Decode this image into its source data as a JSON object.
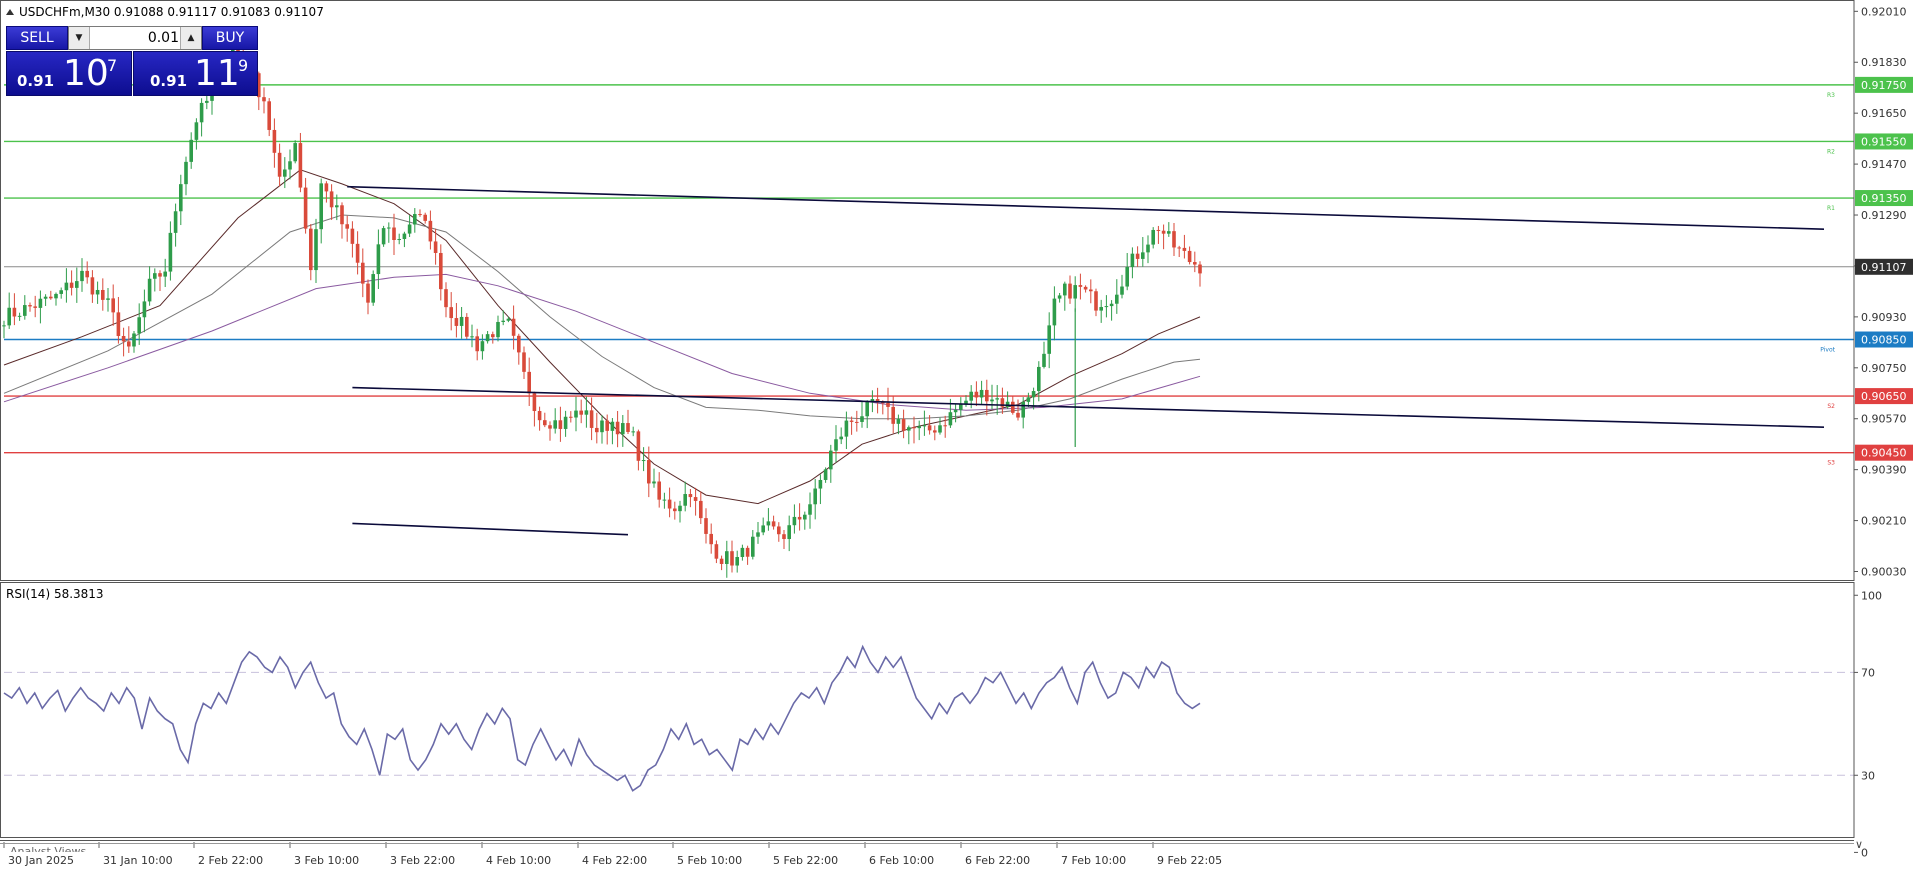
{
  "header": {
    "symbol_line": "USDCHFm,M30  0.91088 0.91117 0.91083 0.91107",
    "symbol_icon": "triangle-up-icon"
  },
  "trade_panel": {
    "sell_label": "SELL",
    "buy_label": "BUY",
    "lot_value": "0.01",
    "bid_prefix": "0.91",
    "bid_big": "10",
    "bid_sup": "7",
    "ask_prefix": "0.91",
    "ask_big": "11",
    "ask_sup": "9",
    "button_color": "#2323b8"
  },
  "indicator": {
    "label": "RSI(14) 58.3813"
  },
  "bottom_tab": "Analyst Views",
  "chart_data": [
    {
      "type": "candlestick",
      "symbol": "USDCHFm",
      "timeframe": "M30",
      "ylim": [
        0.9,
        0.9205
      ],
      "y_ticks": [
        "0.92010",
        "0.91830",
        "0.91650",
        "0.91470",
        "0.91290",
        "0.91110",
        "0.90930",
        "0.90750",
        "0.90570",
        "0.90390",
        "0.90210",
        "0.90030"
      ],
      "x_ticks": [
        "30 Jan 2025",
        "31 Jan 10:00",
        "2 Feb 22:00",
        "3 Feb 10:00",
        "3 Feb 22:00",
        "4 Feb 10:00",
        "4 Feb 22:00",
        "5 Feb 10:00",
        "5 Feb 22:00",
        "6 Feb 10:00",
        "6 Feb 22:00",
        "7 Feb 10:00",
        "9 Feb 22:05"
      ],
      "current_price": {
        "value": 0.91107,
        "label": "0.91107",
        "color": "#2f2f2f"
      },
      "levels": [
        {
          "name": "R3",
          "value": 0.9175,
          "label": "0.91750",
          "color": "#4cc24c"
        },
        {
          "name": "R2",
          "value": 0.9155,
          "label": "0.91550",
          "color": "#4cc24c"
        },
        {
          "name": "R1",
          "value": 0.9135,
          "label": "0.91350",
          "color": "#4cc24c"
        },
        {
          "name": "Pivot",
          "value": 0.9085,
          "label": "0.90850",
          "color": "#1c7cc4"
        },
        {
          "name": "S2",
          "value": 0.9065,
          "label": "0.90650",
          "color": "#e04040"
        },
        {
          "name": "S3",
          "value": 0.9045,
          "label": "0.90450",
          "color": "#e04040"
        }
      ],
      "key_points": [
        [
          0,
          0.9093
        ],
        [
          10,
          0.91
        ],
        [
          15,
          0.9108
        ],
        [
          20,
          0.9097
        ],
        [
          24,
          0.908
        ],
        [
          28,
          0.9104
        ],
        [
          31,
          0.911
        ],
        [
          34,
          0.9142
        ],
        [
          37,
          0.9163
        ],
        [
          40,
          0.9172
        ],
        [
          44,
          0.9189
        ],
        [
          47,
          0.918
        ],
        [
          50,
          0.917
        ],
        [
          53,
          0.914
        ],
        [
          56,
          0.9155
        ],
        [
          59,
          0.911
        ],
        [
          61,
          0.914
        ],
        [
          64,
          0.913
        ],
        [
          67,
          0.9118
        ],
        [
          70,
          0.9098
        ],
        [
          73,
          0.9125
        ],
        [
          76,
          0.912
        ],
        [
          79,
          0.913
        ],
        [
          82,
          0.9122
        ],
        [
          85,
          0.9097
        ],
        [
          88,
          0.909
        ],
        [
          91,
          0.9083
        ],
        [
          94,
          0.9088
        ],
        [
          97,
          0.909
        ],
        [
          100,
          0.9072
        ],
        [
          103,
          0.9058
        ],
        [
          107,
          0.9055
        ],
        [
          111,
          0.906
        ],
        [
          114,
          0.9053
        ],
        [
          117,
          0.9056
        ],
        [
          121,
          0.905
        ],
        [
          123,
          0.904
        ],
        [
          126,
          0.9028
        ],
        [
          129,
          0.9026
        ],
        [
          132,
          0.9032
        ],
        [
          135,
          0.9015
        ],
        [
          138,
          0.9008
        ],
        [
          141,
          0.9007
        ],
        [
          144,
          0.9013
        ],
        [
          147,
          0.9018
        ],
        [
          150,
          0.9016
        ],
        [
          153,
          0.9022
        ],
        [
          156,
          0.903
        ],
        [
          159,
          0.9045
        ],
        [
          162,
          0.9055
        ],
        [
          165,
          0.9059
        ],
        [
          168,
          0.9062
        ],
        [
          171,
          0.9057
        ],
        [
          174,
          0.9054
        ],
        [
          177,
          0.9052
        ],
        [
          180,
          0.9055
        ],
        [
          183,
          0.906
        ],
        [
          186,
          0.9065
        ],
        [
          189,
          0.9066
        ],
        [
          192,
          0.9063
        ],
        [
          195,
          0.9059
        ],
        [
          197,
          0.9065
        ],
        [
          200,
          0.9078
        ],
        [
          202,
          0.9097
        ],
        [
          204,
          0.9102
        ],
        [
          207,
          0.9103
        ],
        [
          210,
          0.9098
        ],
        [
          213,
          0.91
        ],
        [
          216,
          0.911
        ],
        [
          219,
          0.9118
        ],
        [
          222,
          0.9125
        ],
        [
          225,
          0.9118
        ],
        [
          228,
          0.9113
        ],
        [
          230,
          0.9111
        ]
      ],
      "moving_averages": [
        {
          "color": "#5a2a2a",
          "points": [
            [
              0,
              0.9076
            ],
            [
              15,
              0.9086
            ],
            [
              30,
              0.9097
            ],
            [
              45,
              0.9128
            ],
            [
              57,
              0.9145
            ],
            [
              65,
              0.914
            ],
            [
              75,
              0.9133
            ],
            [
              85,
              0.912
            ],
            [
              95,
              0.9097
            ],
            [
              105,
              0.9077
            ],
            [
              115,
              0.9058
            ],
            [
              125,
              0.9041
            ],
            [
              135,
              0.903
            ],
            [
              145,
              0.9027
            ],
            [
              155,
              0.9035
            ],
            [
              165,
              0.9048
            ],
            [
              175,
              0.9054
            ],
            [
              185,
              0.9058
            ],
            [
              195,
              0.9062
            ],
            [
              205,
              0.9072
            ],
            [
              215,
              0.908
            ],
            [
              222,
              0.9087
            ],
            [
              230,
              0.9093
            ]
          ]
        },
        {
          "color": "#7a7a7a",
          "points": [
            [
              0,
              0.9066
            ],
            [
              20,
              0.9081
            ],
            [
              40,
              0.9101
            ],
            [
              55,
              0.9123
            ],
            [
              65,
              0.9129
            ],
            [
              75,
              0.9128
            ],
            [
              85,
              0.9123
            ],
            [
              95,
              0.9109
            ],
            [
              105,
              0.9093
            ],
            [
              115,
              0.9079
            ],
            [
              125,
              0.9068
            ],
            [
              135,
              0.9061
            ],
            [
              145,
              0.906
            ],
            [
              155,
              0.9058
            ],
            [
              165,
              0.9057
            ],
            [
              175,
              0.9057
            ],
            [
              185,
              0.9058
            ],
            [
              195,
              0.906
            ],
            [
              205,
              0.9064
            ],
            [
              215,
              0.9071
            ],
            [
              225,
              0.9077
            ],
            [
              230,
              0.9078
            ]
          ]
        },
        {
          "color": "#8a5aa0",
          "points": [
            [
              0,
              0.9063
            ],
            [
              20,
              0.9075
            ],
            [
              40,
              0.9088
            ],
            [
              60,
              0.9103
            ],
            [
              75,
              0.9107
            ],
            [
              85,
              0.9108
            ],
            [
              95,
              0.9104
            ],
            [
              110,
              0.9095
            ],
            [
              125,
              0.9084
            ],
            [
              140,
              0.9073
            ],
            [
              155,
              0.9066
            ],
            [
              170,
              0.9062
            ],
            [
              185,
              0.906
            ],
            [
              200,
              0.9061
            ],
            [
              215,
              0.9064
            ],
            [
              230,
              0.9072
            ]
          ]
        }
      ],
      "trendlines": [
        {
          "color": "#0a0a3a",
          "from": [
            66,
            0.9139
          ],
          "to": [
            350,
            0.9124
          ]
        },
        {
          "color": "#0a0a3a",
          "from": [
            67,
            0.9068
          ],
          "to": [
            350,
            0.9054
          ]
        },
        {
          "color": "#0a0a3a",
          "from": [
            67,
            0.902
          ],
          "to": [
            120,
            0.9016
          ]
        }
      ],
      "spike_wick": {
        "x": 206,
        "high": 0.9096,
        "low": 0.9047
      }
    },
    {
      "type": "line",
      "title": "RSI(14) 58.3813",
      "ylim": [
        0,
        100
      ],
      "y_ticks": [
        "100",
        "70",
        "30",
        "0"
      ],
      "levels": [
        70,
        30
      ],
      "series": [
        {
          "color": "#6a6aa8",
          "values": [
            62,
            60,
            64,
            58,
            62,
            56,
            60,
            63,
            55,
            60,
            64,
            60,
            58,
            55,
            62,
            58,
            64,
            60,
            48,
            60,
            55,
            52,
            50,
            40,
            35,
            50,
            58,
            56,
            62,
            58,
            66,
            74,
            78,
            76,
            72,
            70,
            76,
            72,
            64,
            70,
            74,
            66,
            60,
            62,
            50,
            45,
            42,
            48,
            40,
            30,
            46,
            44,
            48,
            36,
            32,
            36,
            42,
            50,
            46,
            50,
            44,
            40,
            48,
            54,
            50,
            56,
            52,
            36,
            34,
            42,
            48,
            42,
            36,
            40,
            34,
            44,
            38,
            34,
            32,
            30,
            28,
            30,
            24,
            26,
            32,
            34,
            40,
            48,
            44,
            50,
            42,
            44,
            38,
            40,
            36,
            32,
            44,
            42,
            48,
            44,
            50,
            46,
            52,
            58,
            62,
            60,
            64,
            58,
            66,
            70,
            76,
            72,
            80,
            74,
            70,
            76,
            72,
            76,
            68,
            60,
            56,
            52,
            58,
            54,
            60,
            62,
            58,
            62,
            68,
            66,
            70,
            64,
            58,
            62,
            56,
            62,
            66,
            68,
            72,
            64,
            58,
            70,
            74,
            66,
            60,
            62,
            70,
            68,
            64,
            72,
            68,
            74,
            72,
            62,
            58,
            56,
            58
          ]
        }
      ]
    }
  ]
}
